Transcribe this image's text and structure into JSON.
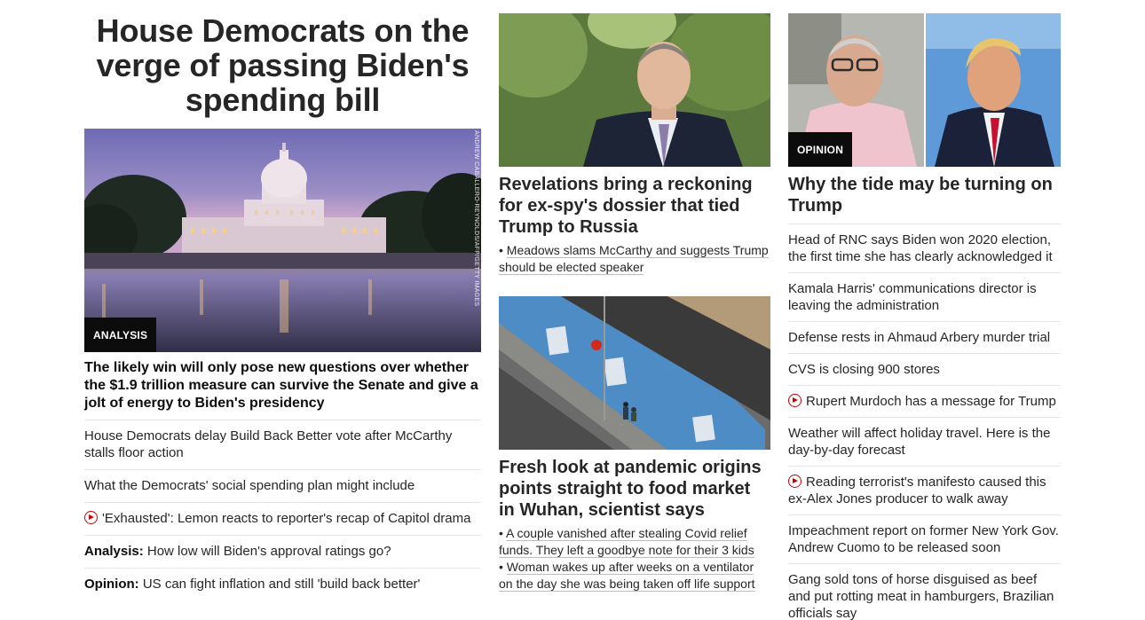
{
  "lead": {
    "headline": "House Democrats on the verge of passing Biden's spending bill",
    "photo_credit": "ANDREW CABALLERO-REYNOLDS/AFP/GETTY IMAGES",
    "tag": "ANALYSIS",
    "subheadline": "The likely win will only pose new questions over whether the $1.9 trillion measure can survive the Senate and give a jolt of energy to Biden's presidency",
    "links": [
      {
        "text": "House Democrats delay Build Back Better vote after McCarthy stalls floor action"
      },
      {
        "text": "What the Democrats' social spending plan might include"
      },
      {
        "text": "'Exhausted': Lemon reacts to reporter's recap of Capitol drama",
        "icon": "play-icon"
      },
      {
        "kicker": "Analysis:",
        "text": "How low will Biden's approval ratings go?"
      },
      {
        "kicker": "Opinion:",
        "text": "US can fight inflation and still 'build back better'"
      }
    ]
  },
  "middle": {
    "story1": {
      "headline": "Revelations bring a reckoning for ex-spy's dossier that tied Trump to Russia",
      "bullets": [
        "Meadows slams McCarthy and suggests Trump should be elected speaker"
      ]
    },
    "story2": {
      "headline": "Fresh look at pandemic origins points straight to food market in Wuhan, scientist says",
      "bullets": [
        "A couple vanished after stealing Covid relief funds. They left a goodbye note for their 3 kids",
        "Woman wakes up after weeks on a ventilator on the day she was being taken off life support"
      ]
    }
  },
  "right": {
    "tag": "OPINION",
    "headline": "Why the tide may be turning on Trump",
    "links": [
      {
        "text": "Head of RNC says Biden won 2020 election, the first time she has clearly acknowledged it"
      },
      {
        "text": "Kamala Harris' communications director is leaving the administration"
      },
      {
        "text": "Defense rests in Ahmaud Arbery murder trial"
      },
      {
        "text": "CVS is closing 900 stores"
      },
      {
        "text": "Rupert Murdoch has a message for Trump",
        "icon": "play-icon"
      },
      {
        "text": "Weather will affect holiday travel. Here is the day-by-day forecast"
      },
      {
        "text": "Reading terrorist's manifesto caused this ex-Alex Jones producer to walk away",
        "icon": "play-icon"
      },
      {
        "text": "Impeachment report on former New York Gov. Andrew Cuomo to be released soon"
      },
      {
        "text": "Gang sold tons of horse disguised as beef and put rotting meat in hamburgers, Brazilian officials say"
      }
    ]
  },
  "colors": {
    "text": "#262626",
    "tag_bg": "#0c0c0c",
    "play_icon": "#cc0000",
    "divider": "#e6e6e6"
  }
}
